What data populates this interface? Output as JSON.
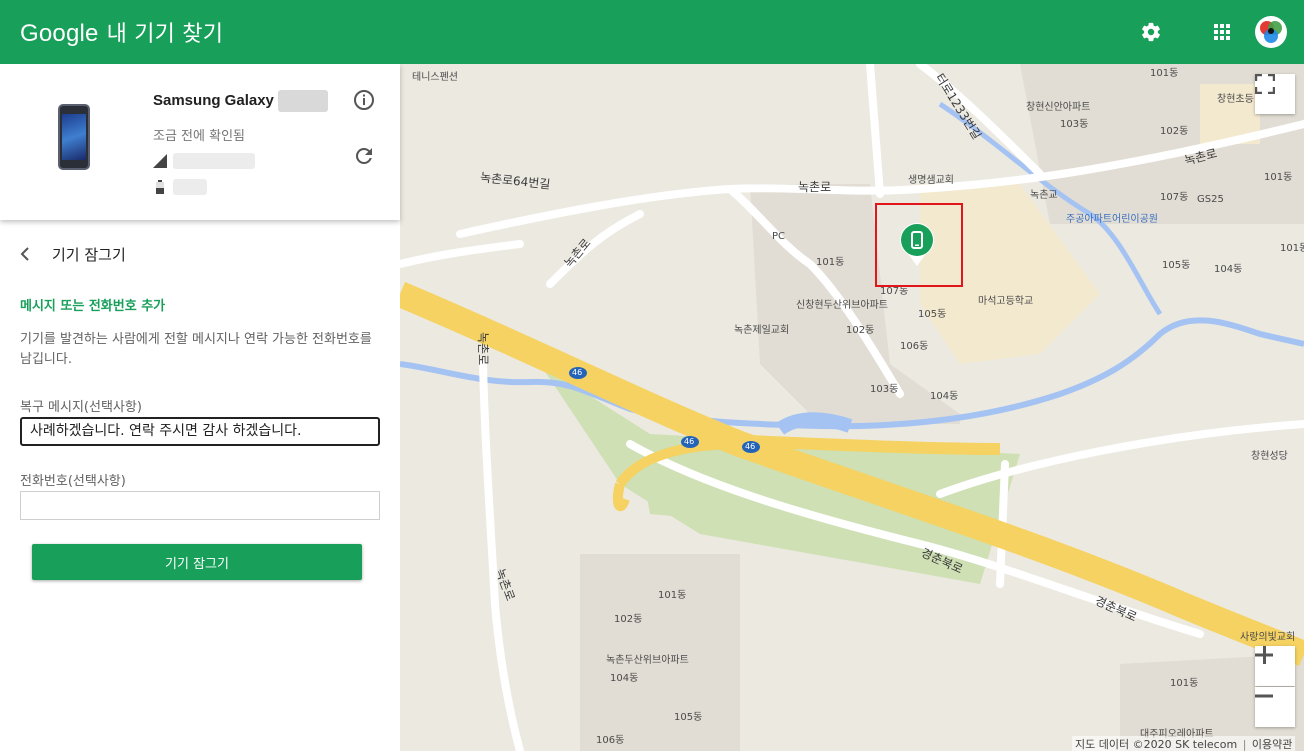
{
  "header": {
    "brand": "Google",
    "product": "내 기기 찾기",
    "settings_icon": "gear-icon",
    "apps_icon": "apps-grid-icon",
    "accent": "#18a05b"
  },
  "device": {
    "name": "Samsung Galaxy",
    "status": "조금 전에 확인됨",
    "info_icon": "info-icon",
    "refresh_icon": "refresh-icon",
    "signal_icon": "signal-icon",
    "battery_icon": "battery-icon"
  },
  "lock": {
    "title": "기기 잠그기",
    "section_title": "메시지 또는 전화번호 추가",
    "description": "기기를 발견하는 사람에게 전할 메시지나 연락 가능한 전화번호를 남깁니다.",
    "message_label": "복구 메시지(선택사항)",
    "message_value": "사례하겠습니다. 연락 주시면 감사 하겠습니다.",
    "phone_label": "전화번호(선택사항)",
    "phone_value": "",
    "button_label": "기기 잠그기"
  },
  "map": {
    "labels": {
      "tennis": "테니스펜션",
      "road_1233": "터로1233번길",
      "changhyeon_apt": "창현신안아파트",
      "changhyeon_elem": "창현초등",
      "d101_top": "101동",
      "d103_top": "103동",
      "d102_top": "102동",
      "nokchon_ro_right": "녹촌로",
      "saengmyeong": "생명샘교회",
      "nokchon_64": "녹촌로64번길",
      "nokchon_ro_mid": "녹촌로",
      "nokchongyo": "녹촌교",
      "d107_right": "107동",
      "gs25": "GS25",
      "d101_right": "101동",
      "jugong": "주공아파트어린이공원",
      "pc": "PC",
      "nokchon_ro_left": "녹촌로",
      "d101_mid": "101동",
      "d107_mid": "107동",
      "sinchang": "신창현두산위브아파트",
      "d105_right": "105동",
      "d104_right": "104동",
      "d105_mid": "105동",
      "d101_far": "101동",
      "maseok": "마석고등학교",
      "nokchon_church": "녹촌제일교회",
      "d102_mid": "102동",
      "d106_mid": "106동",
      "d103_mid": "103동",
      "d104_mid": "104동",
      "rt46_a": "46",
      "rt46_b": "46",
      "rt46_c": "46",
      "nokchon_vert": "녹촌로",
      "changhyeon_cath": "창현성당",
      "gyeongchun_1": "경춘북로",
      "gyeongchun_2": "경춘북로",
      "nokchon_lower": "녹촌로",
      "d101_low": "101동",
      "d102_low": "102동",
      "nokchon_doosan": "녹촌두산위브아파트",
      "d104_low": "104동",
      "d105_low": "105동",
      "d106_low": "106동",
      "sarang": "사랑의빛교회",
      "d101_br": "101동",
      "daeju": "대주피오레아파트"
    },
    "attribution": "지도 데이터 ©2020 SK telecom",
    "terms": "이용약관",
    "fullscreen_icon": "fullscreen-icon",
    "zoom_in_icon": "plus-icon",
    "zoom_out_icon": "minus-icon",
    "marker_icon": "phone-marker-icon",
    "highlight_color": "#e0161a"
  }
}
